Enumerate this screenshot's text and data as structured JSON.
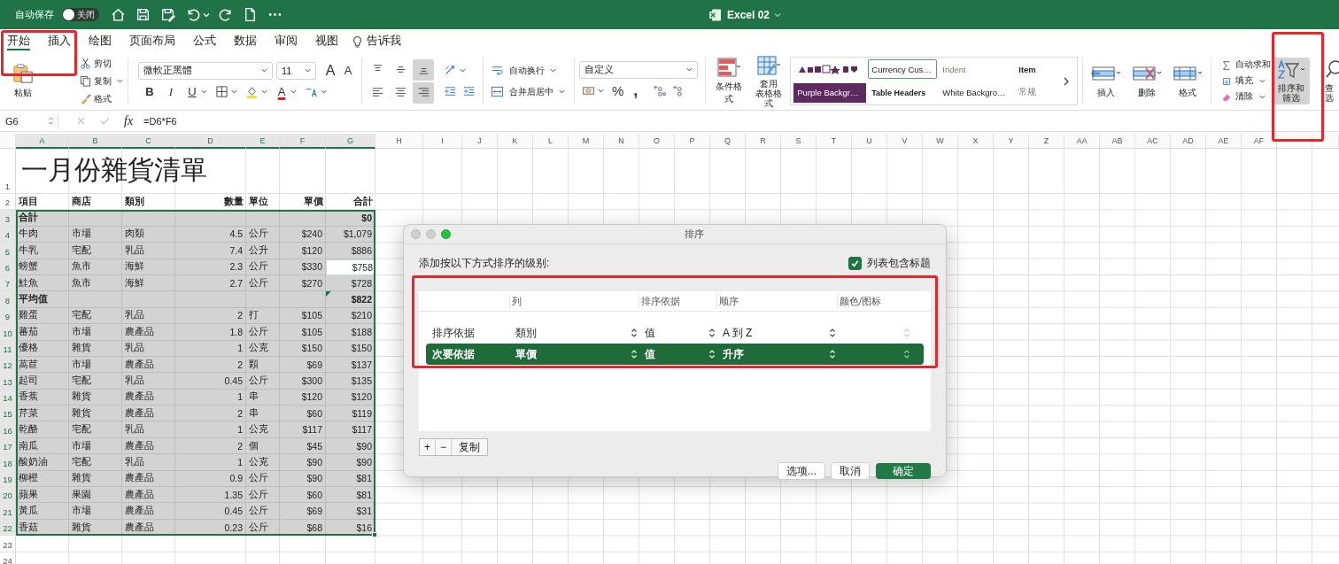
{
  "title_bar": {
    "autosave_label": "自动保存",
    "autosave": {
      "on": false,
      "label": "关闭"
    },
    "document_title": "Excel 02"
  },
  "tabs": [
    {
      "label": "开始",
      "selected": true
    },
    {
      "label": "插入",
      "selected": false
    },
    {
      "label": "绘图",
      "selected": false
    },
    {
      "label": "页面布局",
      "selected": false
    },
    {
      "label": "公式",
      "selected": false
    },
    {
      "label": "数据",
      "selected": false
    },
    {
      "label": "审阅",
      "selected": false
    },
    {
      "label": "视图",
      "selected": false
    }
  ],
  "tell_me": "告诉我",
  "ribbon": {
    "paste": "粘贴",
    "cut": "剪切",
    "copy": "复制",
    "format_painter": "格式",
    "font_name": "微軟正黑體",
    "font_size": "11",
    "grow_font": "A",
    "shrink_font": "A",
    "bold": "B",
    "italic": "I",
    "underline": "U",
    "font_color": "A",
    "alignment": [
      {
        "kind": "top",
        "selected": false
      },
      {
        "kind": "middle",
        "selected": false
      },
      {
        "kind": "bottom",
        "selected": true
      },
      {
        "kind": "left",
        "selected": false
      },
      {
        "kind": "center",
        "selected": false
      },
      {
        "kind": "right",
        "selected": true
      }
    ],
    "wrap_text": "自动换行",
    "merge_center": "合并后居中",
    "number_format": "自定义",
    "percent": "%",
    "comma": ",",
    "conditional_format": "条件格式",
    "format_as_table": [
      "套用",
      "表格格式"
    ],
    "styles": [
      {
        "kind": "currency",
        "label": "Currency Cus…",
        "selected": true
      },
      {
        "kind": "indent",
        "label": "Indent",
        "selected": false
      },
      {
        "kind": "item",
        "label": "Item",
        "selected": false
      },
      {
        "kind": "purple",
        "label": "Purple Backgr…",
        "selected": false
      },
      {
        "kind": "headers",
        "label": "Table Headers",
        "selected": false
      },
      {
        "kind": "white",
        "label": "White Backgro…",
        "selected": false
      },
      {
        "kind": "normal",
        "label": "常规",
        "selected": false
      }
    ],
    "cells": [
      "插入",
      "删除",
      "格式"
    ],
    "autosum": "自动求和",
    "fill": "填充",
    "clear": "清除",
    "sort_filter": {
      "lines": [
        "排序和",
        "筛选"
      ],
      "selected": true
    },
    "find": [
      "查",
      "选"
    ]
  },
  "formula_bar": {
    "name_box": "G6",
    "fx": "fx",
    "formula": "=D6*F6"
  },
  "sheet": {
    "columns": [
      {
        "label": "A",
        "selected": true
      },
      {
        "label": "B",
        "selected": true
      },
      {
        "label": "C",
        "selected": true
      },
      {
        "label": "D",
        "selected": true
      },
      {
        "label": "E",
        "selected": true
      },
      {
        "label": "F",
        "selected": true
      },
      {
        "label": "G",
        "selected": true
      },
      {
        "label": "H",
        "selected": false
      },
      {
        "label": "I",
        "selected": false
      },
      {
        "label": "J",
        "selected": false
      },
      {
        "label": "K",
        "selected": false
      },
      {
        "label": "L",
        "selected": false
      },
      {
        "label": "M",
        "selected": false
      },
      {
        "label": "N",
        "selected": false
      },
      {
        "label": "O",
        "selected": false
      },
      {
        "label": "P",
        "selected": false
      },
      {
        "label": "Q",
        "selected": false
      },
      {
        "label": "R",
        "selected": false
      },
      {
        "label": "S",
        "selected": false
      },
      {
        "label": "T",
        "selected": false
      },
      {
        "label": "U",
        "selected": false
      },
      {
        "label": "V",
        "selected": false
      },
      {
        "label": "W",
        "selected": false
      },
      {
        "label": "X",
        "selected": false
      },
      {
        "label": "Y",
        "selected": false
      },
      {
        "label": "Z",
        "selected": false
      },
      {
        "label": "AA",
        "selected": false
      },
      {
        "label": "AB",
        "selected": false
      },
      {
        "label": "AC",
        "selected": false
      },
      {
        "label": "AD",
        "selected": false
      },
      {
        "label": "AE",
        "selected": false
      },
      {
        "label": "AF",
        "selected": false
      }
    ],
    "title_row": {
      "number": "1",
      "title": "一月份雜貨清單"
    },
    "header_row": {
      "number": "2",
      "item": "項目",
      "store": "商店",
      "category": "類別",
      "qty": "數量",
      "unit": "單位",
      "price": "單價",
      "total": "合計"
    },
    "rows": [
      {
        "number": "3",
        "kind": "summary",
        "selected": true,
        "active": false,
        "flagged": false,
        "item": "合計",
        "total": "$0"
      },
      {
        "number": "4",
        "kind": "item",
        "selected": true,
        "active": false,
        "flagged": false,
        "item": "牛肉",
        "store": "市場",
        "category": "肉類",
        "qty": "4.5",
        "unit": "公斤",
        "price": "$240",
        "total": "$1,079"
      },
      {
        "number": "5",
        "kind": "item",
        "selected": true,
        "active": false,
        "flagged": false,
        "item": "牛乳",
        "store": "宅配",
        "category": "乳品",
        "qty": "7.4",
        "unit": "公升",
        "price": "$120",
        "total": "$886"
      },
      {
        "number": "6",
        "kind": "item",
        "selected": true,
        "active": true,
        "flagged": false,
        "item": "螃蟹",
        "store": "魚市",
        "category": "海鮮",
        "qty": "2.3",
        "unit": "公斤",
        "price": "$330",
        "total": "$758"
      },
      {
        "number": "7",
        "kind": "item",
        "selected": true,
        "active": false,
        "flagged": false,
        "item": "鮭魚",
        "store": "魚市",
        "category": "海鮮",
        "qty": "2.7",
        "unit": "公斤",
        "price": "$270",
        "total": "$728"
      },
      {
        "number": "8",
        "kind": "summary",
        "selected": true,
        "active": false,
        "flagged": true,
        "item": "平均值",
        "total": "$822"
      },
      {
        "number": "9",
        "kind": "item",
        "selected": true,
        "active": false,
        "flagged": false,
        "item": "雞蛋",
        "store": "宅配",
        "category": "乳品",
        "qty": "2",
        "unit": "打",
        "price": "$105",
        "total": "$210"
      },
      {
        "number": "10",
        "kind": "item",
        "selected": true,
        "active": false,
        "flagged": false,
        "item": "蕃茄",
        "store": "市場",
        "category": "農產品",
        "qty": "1.8",
        "unit": "公斤",
        "price": "$105",
        "total": "$188"
      },
      {
        "number": "11",
        "kind": "item",
        "selected": true,
        "active": false,
        "flagged": false,
        "item": "優格",
        "store": "雜貨",
        "category": "乳品",
        "qty": "1",
        "unit": "公克",
        "price": "$150",
        "total": "$150"
      },
      {
        "number": "12",
        "kind": "item",
        "selected": true,
        "active": false,
        "flagged": false,
        "item": "萵苣",
        "store": "市場",
        "category": "農產品",
        "qty": "2",
        "unit": "顆",
        "price": "$69",
        "total": "$137"
      },
      {
        "number": "13",
        "kind": "item",
        "selected": true,
        "active": false,
        "flagged": false,
        "item": "起司",
        "store": "宅配",
        "category": "乳品",
        "qty": "0.45",
        "unit": "公斤",
        "price": "$300",
        "total": "$135"
      },
      {
        "number": "14",
        "kind": "item",
        "selected": true,
        "active": false,
        "flagged": false,
        "item": "香蕉",
        "store": "雜貨",
        "category": "農產品",
        "qty": "1",
        "unit": "串",
        "price": "$120",
        "total": "$120"
      },
      {
        "number": "15",
        "kind": "item",
        "selected": true,
        "active": false,
        "flagged": false,
        "item": "芹菜",
        "store": "雜貨",
        "category": "農產品",
        "qty": "2",
        "unit": "串",
        "price": "$60",
        "total": "$119"
      },
      {
        "number": "16",
        "kind": "item",
        "selected": true,
        "active": false,
        "flagged": false,
        "item": "乾酪",
        "store": "宅配",
        "category": "乳品",
        "qty": "1",
        "unit": "公克",
        "price": "$117",
        "total": "$117"
      },
      {
        "number": "17",
        "kind": "item",
        "selected": true,
        "active": false,
        "flagged": false,
        "item": "南瓜",
        "store": "市場",
        "category": "農產品",
        "qty": "2",
        "unit": "個",
        "price": "$45",
        "total": "$90"
      },
      {
        "number": "18",
        "kind": "item",
        "selected": true,
        "active": false,
        "flagged": false,
        "item": "酸奶油",
        "store": "宅配",
        "category": "乳品",
        "qty": "1",
        "unit": "公克",
        "price": "$90",
        "total": "$90"
      },
      {
        "number": "19",
        "kind": "item",
        "selected": true,
        "active": false,
        "flagged": false,
        "item": "柳橙",
        "store": "雜貨",
        "category": "農產品",
        "qty": "0.9",
        "unit": "公斤",
        "price": "$90",
        "total": "$81"
      },
      {
        "number": "20",
        "kind": "item",
        "selected": true,
        "active": false,
        "flagged": false,
        "item": "蘋果",
        "store": "果園",
        "category": "農產品",
        "qty": "1.35",
        "unit": "公斤",
        "price": "$60",
        "total": "$81"
      },
      {
        "number": "21",
        "kind": "item",
        "selected": true,
        "active": false,
        "flagged": false,
        "item": "黃瓜",
        "store": "市場",
        "category": "農產品",
        "qty": "0.45",
        "unit": "公斤",
        "price": "$69",
        "total": "$31"
      },
      {
        "number": "22",
        "kind": "item",
        "selected": true,
        "active": false,
        "flagged": false,
        "item": "香菇",
        "store": "雜貨",
        "category": "農產品",
        "qty": "0.23",
        "unit": "公斤",
        "price": "$68",
        "total": "$16"
      }
    ],
    "empty_rows": [
      "23",
      "24"
    ]
  },
  "sort_dialog": {
    "title": "排序",
    "prompt": "添加按以下方式排序的级别:",
    "has_headers": {
      "label": "列表包含标题",
      "checked": true
    },
    "headers": [
      "列",
      "排序依据",
      "顺序",
      "颜色/图标"
    ],
    "levels": [
      {
        "label": "排序依据",
        "column": "類別",
        "sort_on": "值",
        "order": "A 到 Z",
        "selected": false
      },
      {
        "label": "次要依据",
        "column": "單價",
        "sort_on": "值",
        "order": "升序",
        "selected": true
      }
    ],
    "add": "+",
    "remove": "−",
    "copy": "复制",
    "options": "选项...",
    "cancel": "取消",
    "ok": "确定"
  }
}
